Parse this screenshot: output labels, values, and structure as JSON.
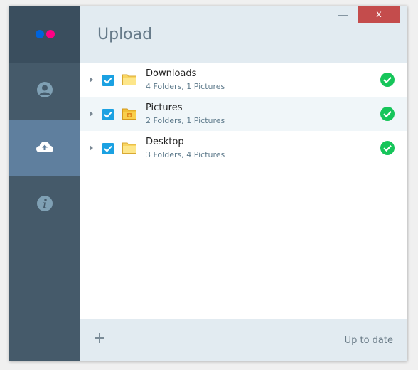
{
  "app": {
    "title": "Upload",
    "window_buttons": {
      "minimize": "—",
      "close": "x"
    },
    "colors": {
      "sidebar": "#455a6a",
      "sidebar_active": "#5f7f9e",
      "header": "#e2ebf1",
      "close_button": "#c44c4c",
      "checkbox": "#1ba1e2",
      "status_ok": "#16c55a",
      "logo_blue": "#0063dc",
      "logo_pink": "#ff0084"
    }
  },
  "sidebar": {
    "items": [
      {
        "name": "profile",
        "icon": "user-icon",
        "active": false
      },
      {
        "name": "upload",
        "icon": "cloud-upload-icon",
        "active": true
      },
      {
        "name": "info",
        "icon": "info-icon",
        "active": false
      }
    ]
  },
  "folders": [
    {
      "name": "Downloads",
      "summary": "4 Folders, 1 Pictures",
      "checked": true,
      "icon": "folder-icon",
      "status": "check-circle-icon"
    },
    {
      "name": "Pictures",
      "summary": "2 Folders, 1 Pictures",
      "checked": true,
      "icon": "pictures-folder-icon",
      "status": "check-circle-icon"
    },
    {
      "name": "Desktop",
      "summary": "3 Folders, 4 Pictures",
      "checked": true,
      "icon": "folder-icon",
      "status": "check-circle-icon"
    }
  ],
  "footer": {
    "add_label": "+",
    "status": "Up to date"
  }
}
